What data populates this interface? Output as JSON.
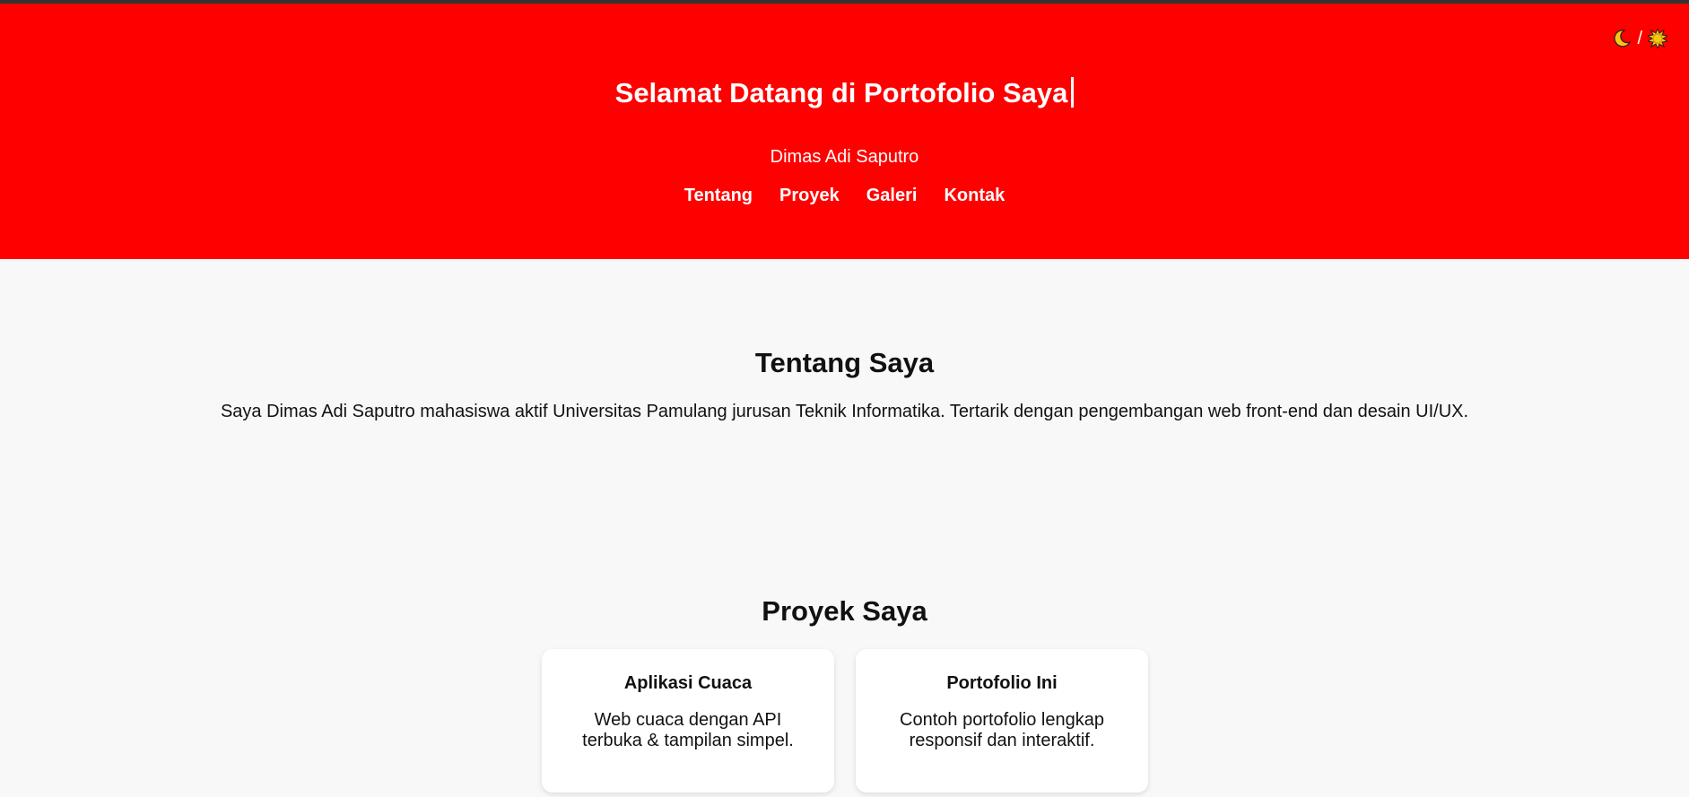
{
  "header": {
    "title": "Selamat Datang di Portofolio Saya",
    "subtitle": "Dimas Adi Saputro",
    "theme_toggle": {
      "separator": "/",
      "moon_icon": "moon-icon",
      "sun_icon": "sun-icon"
    },
    "nav": [
      "Tentang",
      "Proyek",
      "Galeri",
      "Kontak"
    ],
    "background_color": "#ff0000"
  },
  "about": {
    "title": "Tentang Saya",
    "text": "Saya Dimas Adi Saputro mahasiswa aktif Universitas Pamulang jurusan Teknik Informatika. Tertarik dengan pengembangan web front-end dan desain UI/UX."
  },
  "projects": {
    "title": "Proyek Saya",
    "items": [
      {
        "title": "Aplikasi Cuaca",
        "line1": "Web cuaca dengan API",
        "line2": "terbuka & tampilan simpel."
      },
      {
        "title": "Portofolio Ini",
        "line1": "Contoh portofolio lengkap",
        "line2": "responsif dan interaktif."
      }
    ]
  }
}
